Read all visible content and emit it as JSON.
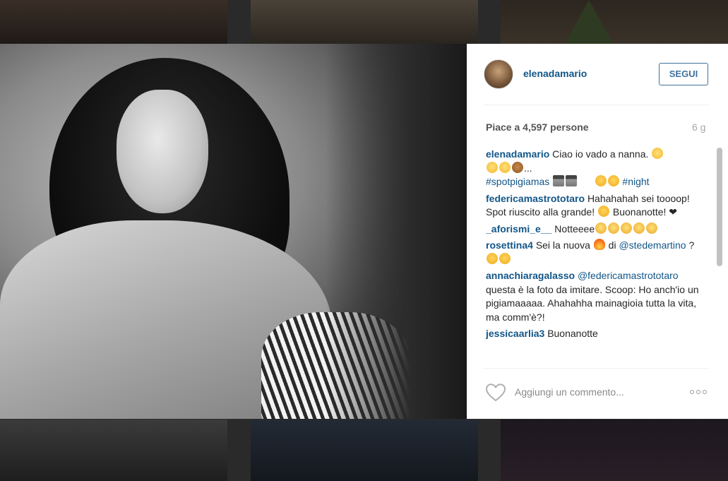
{
  "post": {
    "username": "elenadamario",
    "follow_label": "SEGUI",
    "likes_text": "Piace a 4,597 persone",
    "time_ago": "6 g",
    "caption": {
      "user": "elenadamario",
      "text_line1": "Ciao io vado a nanna.",
      "ellipsis": "...",
      "tags": [
        "#spotpigiamas",
        "#night"
      ]
    },
    "comments": [
      {
        "user": "federicamastrototaro",
        "text": "Hahahahah sei toooop! Spot riuscito alla grande!",
        "text2": "Buonanotte!"
      },
      {
        "user": "_aforismi_e__",
        "text": "Notteeee"
      },
      {
        "user": "rosettina4",
        "text": "Sei la nuova",
        "text_mid": "di",
        "mention": "@stedemartino",
        "text_end": "?"
      },
      {
        "user": "annachiaragalasso",
        "mention": "@federicamastrototaro",
        "text": "questa è la foto da imitare. Scoop: Ho anch'io un pigiamaaaaa. Ahahahha mainagioia tutta la vita, ma comm'è?!"
      },
      {
        "user": "jessicaarlia3",
        "text": "Buonanotte"
      }
    ],
    "comment_placeholder": "Aggiungi un commento...",
    "heart_glyph": "❤"
  },
  "icons": {
    "like": "heart-outline-icon",
    "more": "more-options-icon"
  },
  "colors": {
    "username_blue": "#125688",
    "button_blue": "#3f729b",
    "muted_text": "#a5a7aa"
  }
}
